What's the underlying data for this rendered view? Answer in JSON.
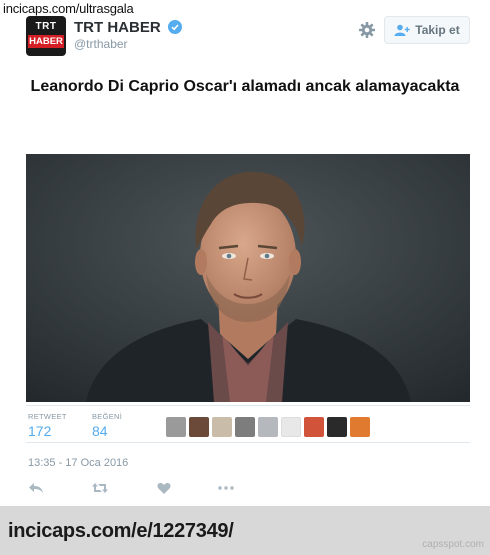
{
  "watermark_top": "incicaps.com/ultrasgala",
  "account": {
    "logo_line1": "TRT",
    "logo_line2": "HABER",
    "name": "TRT HABER",
    "handle": "@trthaber",
    "follow_label": "Takip et"
  },
  "tweet": {
    "text": "Leanordo Di Caprio Oscar'ı alamadı ancak alamayacakta",
    "timestamp": "13:35 - 17 Oca 2016"
  },
  "stats": {
    "retweet_label": "RETWEET",
    "retweet_count": "172",
    "like_label": "BEĞENİ",
    "like_count": "84"
  },
  "footer": {
    "url": "incicaps.com/e/1227349/",
    "site": "capsspot.com"
  },
  "colors": {
    "accent": "#55acee",
    "muted": "#8899a6",
    "logo_red": "#d41f26"
  }
}
